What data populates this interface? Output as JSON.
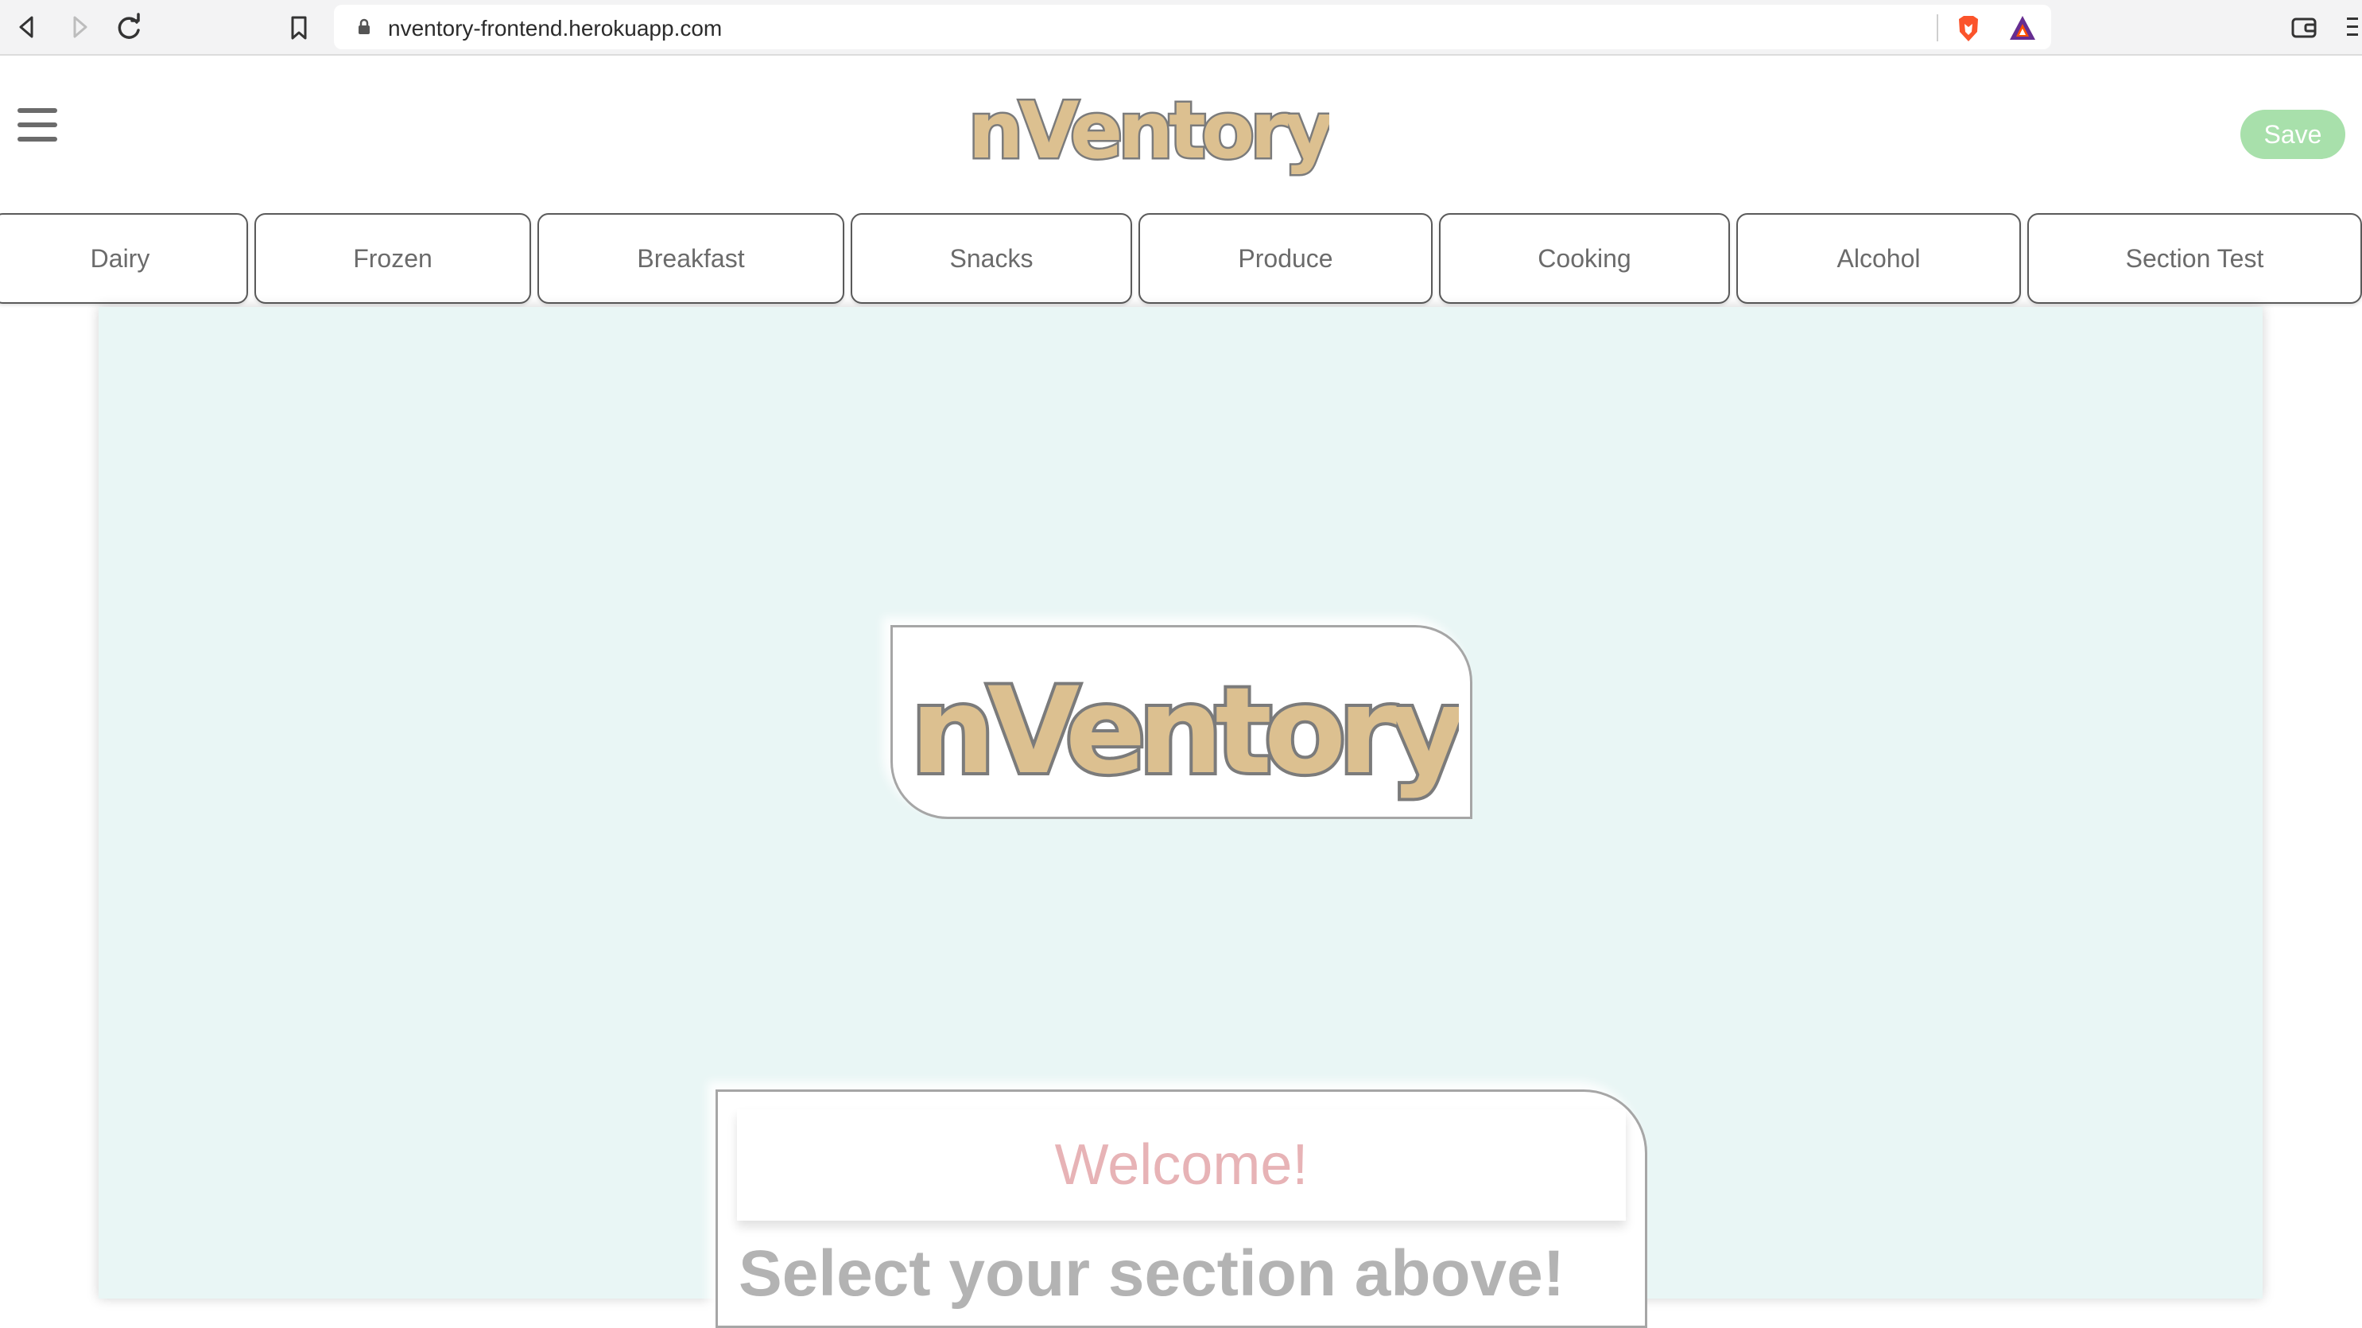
{
  "browser": {
    "url": "nventory-frontend.herokuapp.com"
  },
  "header": {
    "logo_text": "nVentory",
    "save_label": "Save"
  },
  "tabs": [
    {
      "label": "Dairy"
    },
    {
      "label": "Frozen"
    },
    {
      "label": "Breakfast"
    },
    {
      "label": "Snacks"
    },
    {
      "label": "Produce"
    },
    {
      "label": "Cooking"
    },
    {
      "label": "Alcohol"
    },
    {
      "label": "Section Test"
    }
  ],
  "main": {
    "logo_text": "nVentory",
    "welcome_title": "Welcome!",
    "subtitle": "Select your section above!"
  },
  "colors": {
    "panel_bg": "#e9f6f5",
    "save_button": "#a8e0ab",
    "welcome_text": "#e7b3b6",
    "logo_fill": "#dcc090",
    "logo_outline": "#7b7b7b"
  },
  "icons": [
    "back-icon",
    "forward-icon",
    "reload-icon",
    "bookmark-icon",
    "lock-icon",
    "brave-shield-icon",
    "bat-rewards-icon",
    "wallet-icon",
    "menu-icon",
    "hamburger-icon"
  ]
}
